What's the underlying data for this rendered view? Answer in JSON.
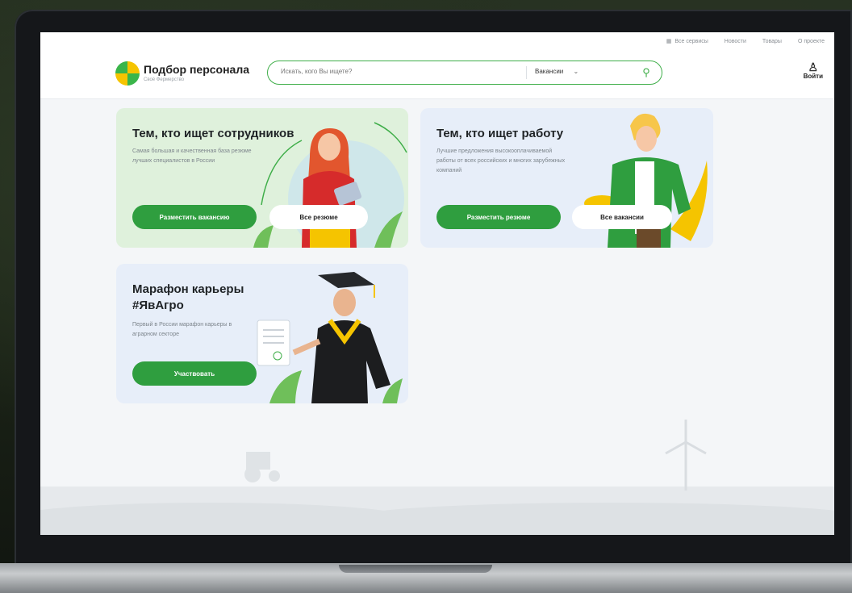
{
  "topnav": {
    "links": [
      "Все сервисы",
      "Новости",
      "Товары",
      "О проекте"
    ]
  },
  "header": {
    "brand_title": "Подбор персонала",
    "brand_sub": "Своё Фермерство",
    "search_placeholder": "Искать, кого Вы ищете?",
    "search_category": "Вакансии",
    "login_label": "Войти"
  },
  "cards": {
    "employers": {
      "title": "Тем, кто ищет сотрудников",
      "text": "Самая большая и качественная база резюме лучших специалистов в России",
      "primary_btn": "Разместить вакансию",
      "secondary_btn": "Все резюме"
    },
    "jobseekers": {
      "title": "Тем, кто ищет работу",
      "text": "Лучшие предложения высокооплачиваемой работы от всех российских и многих зарубежных компаний",
      "primary_btn": "Разместить резюме",
      "secondary_btn": "Все вакансии"
    },
    "marathon": {
      "title_line1": "Марафон карьеры",
      "title_line2": "#ЯвАгро",
      "text": "Первый в России марафон карьеры в аграрном секторе",
      "primary_btn": "Участвовать"
    }
  },
  "colors": {
    "accent": "#2f9e3f",
    "card_green": "#dff1dc",
    "card_blue": "#e7eef9"
  }
}
